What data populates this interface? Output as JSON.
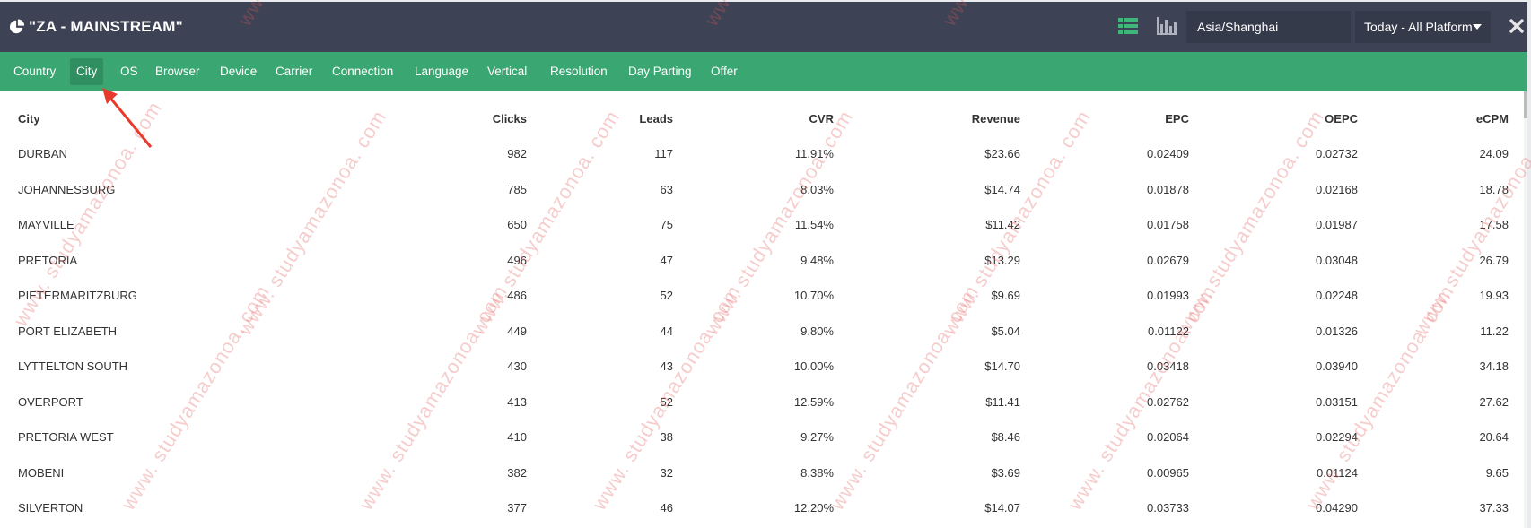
{
  "header": {
    "title": "\"ZA - MAINSTREAM\"",
    "icons": {
      "title_icon": "pie-chart-icon",
      "table_view": "table-view-icon",
      "chart_view": "bar-chart-icon",
      "close": "close-icon"
    },
    "timezone_value": "Asia/Shanghai",
    "range_label": "Today - All Platform"
  },
  "tabs": [
    {
      "label": "Country"
    },
    {
      "label": "City"
    },
    {
      "label": "OS"
    },
    {
      "label": "Browser"
    },
    {
      "label": "Device"
    },
    {
      "label": "Carrier"
    },
    {
      "label": "Connection"
    },
    {
      "label": "Language"
    },
    {
      "label": "Vertical"
    },
    {
      "label": "Resolution"
    },
    {
      "label": "Day Parting"
    },
    {
      "label": "Offer"
    }
  ],
  "active_tab": "City",
  "table": {
    "columns": [
      "City",
      "Clicks",
      "Leads",
      "CVR",
      "Revenue",
      "EPC",
      "OEPC",
      "eCPM"
    ],
    "rows": [
      [
        "DURBAN",
        "982",
        "117",
        "11.91%",
        "$23.66",
        "0.02409",
        "0.02732",
        "24.09"
      ],
      [
        "JOHANNESBURG",
        "785",
        "63",
        "8.03%",
        "$14.74",
        "0.01878",
        "0.02168",
        "18.78"
      ],
      [
        "MAYVILLE",
        "650",
        "75",
        "11.54%",
        "$11.42",
        "0.01758",
        "0.01987",
        "17.58"
      ],
      [
        "PRETORIA",
        "496",
        "47",
        "9.48%",
        "$13.29",
        "0.02679",
        "0.03048",
        "26.79"
      ],
      [
        "PIETERMARITZBURG",
        "486",
        "52",
        "10.70%",
        "$9.69",
        "0.01993",
        "0.02248",
        "19.93"
      ],
      [
        "PORT ELIZABETH",
        "449",
        "44",
        "9.80%",
        "$5.04",
        "0.01122",
        "0.01326",
        "11.22"
      ],
      [
        "LYTTELTON SOUTH",
        "430",
        "43",
        "10.00%",
        "$14.70",
        "0.03418",
        "0.03940",
        "34.18"
      ],
      [
        "OVERPORT",
        "413",
        "52",
        "12.59%",
        "$11.41",
        "0.02762",
        "0.03151",
        "27.62"
      ],
      [
        "PRETORIA WEST",
        "410",
        "38",
        "9.27%",
        "$8.46",
        "0.02064",
        "0.02294",
        "20.64"
      ],
      [
        "MOBENI",
        "382",
        "32",
        "8.38%",
        "$3.69",
        "0.00965",
        "0.01124",
        "9.65"
      ],
      [
        "SILVERTON",
        "377",
        "46",
        "12.20%",
        "$14.07",
        "0.03733",
        "0.04290",
        "37.33"
      ]
    ]
  },
  "watermark": "www. studyamazonoa. com",
  "colors": {
    "topbar": "#3d4254",
    "tabbar": "#3aa772",
    "tab_active": "#2f8f61",
    "arrow": "#e8392c",
    "table_view_icon": "#3fb77a"
  }
}
